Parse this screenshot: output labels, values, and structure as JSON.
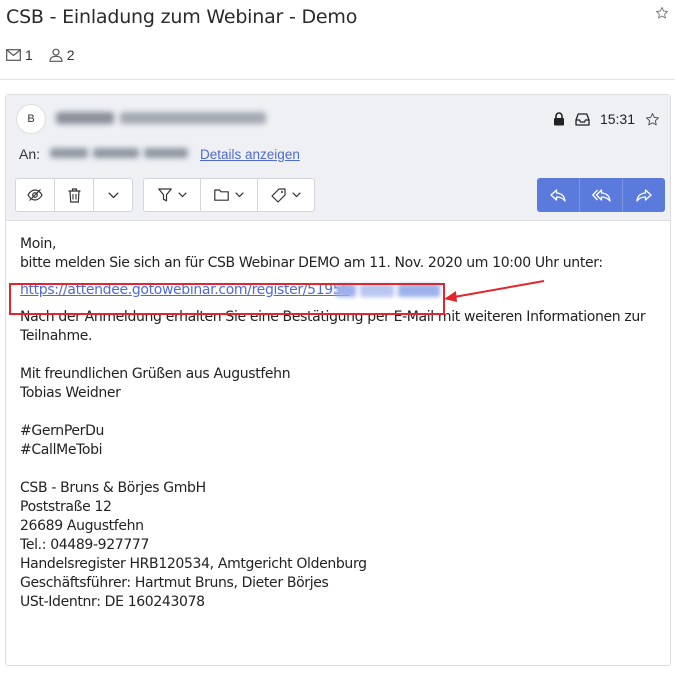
{
  "subject": "CSB - Einladung zum Webinar - Demo",
  "counts": {
    "messages": "1",
    "participants": "2"
  },
  "header": {
    "avatar_letter": "B",
    "time": "15:31",
    "to_label": "An:",
    "details_link": "Details anzeigen"
  },
  "body": {
    "greeting": "Moin,",
    "intro": "bitte melden Sie sich an für CSB Webinar DEMO am 11. Nov. 2020 um 10:00 Uhr unter:",
    "url_visible": "https://attendee.gotowebinar.com/register/51956",
    "after_reg_1": "Nach der Anmeldung erhalten Sie eine Bestätigung per E-Mail mit weiteren Informationen zur",
    "after_reg_2": "Teilnahme.",
    "closing": "Mit freundlichen Grüßen aus Augustfehn",
    "name": "Tobias Weidner",
    "tag1": "#GernPerDu",
    "tag2": "#CallMeTobi",
    "company": "CSB - Bruns & Börjes GmbH",
    "street": "Poststraße 12",
    "city": "26689 Augustfehn",
    "phone": "Tel.: 04489-927777",
    "register": "Handelsregister HRB120534, Amtgericht Oldenburg",
    "managers": "Geschäftsführer: Hartmut Bruns, Dieter Börjes",
    "vat": "USt-Identnr: DE 160243078"
  },
  "colors": {
    "accent": "#5b7bdc",
    "link": "#4e6ad2",
    "highlight": "#e2262b",
    "header_bg": "#eef0f4"
  }
}
